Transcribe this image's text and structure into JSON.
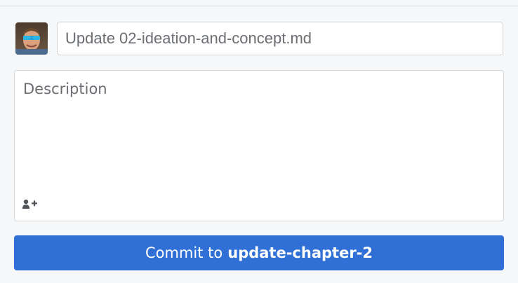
{
  "commit_form": {
    "summary": {
      "placeholder": "Update 02-ideation-and-concept.md",
      "value": ""
    },
    "description": {
      "placeholder": "Description",
      "value": ""
    },
    "icons": {
      "avatar": "user-avatar",
      "coauthor": "add-coauthor-icon"
    },
    "commit_button": {
      "prefix": "Commit to",
      "branch": "update-chapter-2"
    },
    "colors": {
      "accent": "#2f6fd6",
      "background": "#f6f7f8",
      "border": "#d4d7da",
      "placeholder": "#6b6f73"
    }
  }
}
